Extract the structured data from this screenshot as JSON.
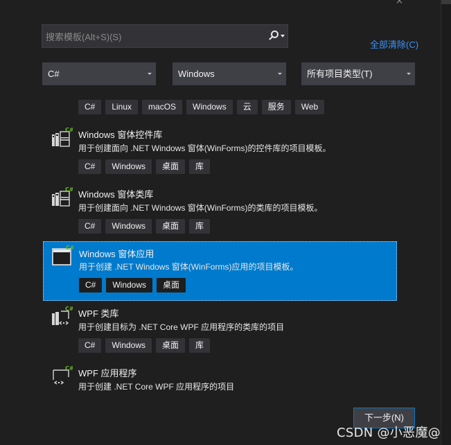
{
  "search": {
    "placeholder": "搜索模板(Alt+S)(S)"
  },
  "clear_all": "全部清除(C)",
  "filters": {
    "language": "C#",
    "platform": "Windows",
    "project_type": "所有项目类型(T)"
  },
  "filter_tags": [
    "C#",
    "Linux",
    "macOS",
    "Windows",
    "云",
    "服务",
    "Web"
  ],
  "templates": [
    {
      "title": "Windows 窗体控件库",
      "description": "用于创建面向 .NET Windows 窗体(WinForms)的控件库的项目模板。",
      "tags": [
        "C#",
        "Windows",
        "桌面",
        "库"
      ],
      "icon": "winforms-library-icon",
      "selected": false
    },
    {
      "title": "Windows 窗体类库",
      "description": "用于创建面向 .NET Windows 窗体(WinForms)的类库的项目模板。",
      "tags": [
        "C#",
        "Windows",
        "桌面",
        "库"
      ],
      "icon": "winforms-library-icon",
      "selected": false
    },
    {
      "title": "Windows 窗体应用",
      "description": "用于创建 .NET Windows 窗体(WinForms)应用的项目模板。",
      "tags": [
        "C#",
        "Windows",
        "桌面"
      ],
      "icon": "winforms-app-icon",
      "selected": true
    },
    {
      "title": "WPF 类库",
      "description": "用于创建目标为 .NET Core WPF 应用程序的类库的项目",
      "tags": [
        "C#",
        "Windows",
        "桌面",
        "库"
      ],
      "icon": "wpf-library-icon",
      "selected": false
    },
    {
      "title": "WPF 应用程序",
      "description": "用于创建 .NET Core WPF 应用程序的项目",
      "tags": [],
      "icon": "wpf-app-icon",
      "selected": false
    }
  ],
  "next_button": "下一步(N)",
  "watermark": "CSDN @小恶魔@",
  "colors": {
    "background": "#1f1f1f",
    "accent": "#007acc",
    "link": "#3794ff",
    "csharp_badge": "#68b723"
  }
}
